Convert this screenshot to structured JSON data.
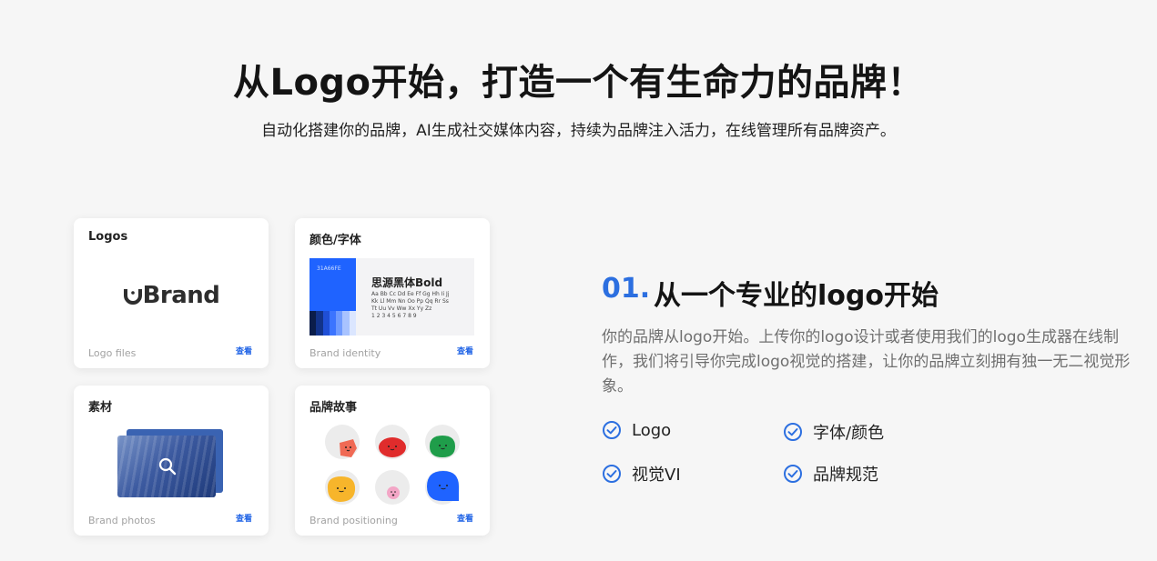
{
  "hero": {
    "title": "从Logo开始，打造一个有生命力的品牌！",
    "subtitle": "自动化搭建你的品牌，AI生成社交媒体内容，持续为品牌注入活力，在线管理所有品牌资产。"
  },
  "cards": {
    "logos": {
      "title": "Logos",
      "brand_text": "Brand",
      "caption": "Logo files",
      "link": "查看"
    },
    "identity": {
      "title": "颜色/字体",
      "hex": "31A66FE",
      "font_name": "思源黑体Bold",
      "glyph_line1": "Aa Bb Cc Dd Ee Ff Gg Hh Ii Jj",
      "glyph_line2": "Kk Ll Mm Nn Oo Pp Qq Rr Ss",
      "glyph_line3": "Tt Uu Vv Ww Xx Yy Zz",
      "glyph_line4": "1 2 3 4 5 6 7 8 9",
      "caption": "Brand identity",
      "link": "查看",
      "palette": [
        "#0b1d4a",
        "#12338a",
        "#1f4fd6",
        "#3b74ff",
        "#6f9bff",
        "#a8c3ff",
        "#dbe6ff"
      ]
    },
    "photos": {
      "title": "素材",
      "caption": "Brand photos",
      "link": "查看"
    },
    "story": {
      "title": "品牌故事",
      "caption": "Brand positioning",
      "link": "查看"
    }
  },
  "feature": {
    "number": "01.",
    "title": "从一个专业的logo开始",
    "description": "你的品牌从logo开始。上传你的logo设计或者使用我们的logo生成器在线制作，我们将引导你完成logo视觉的搭建，让你的品牌立刻拥有独一无二视觉形象。",
    "items": [
      "Logo",
      "字体/颜色",
      "视觉VI",
      "品牌规范"
    ]
  },
  "colors": {
    "accent": "#2c6fe0",
    "link": "#1f63e6",
    "background": "#f6f6f6"
  }
}
